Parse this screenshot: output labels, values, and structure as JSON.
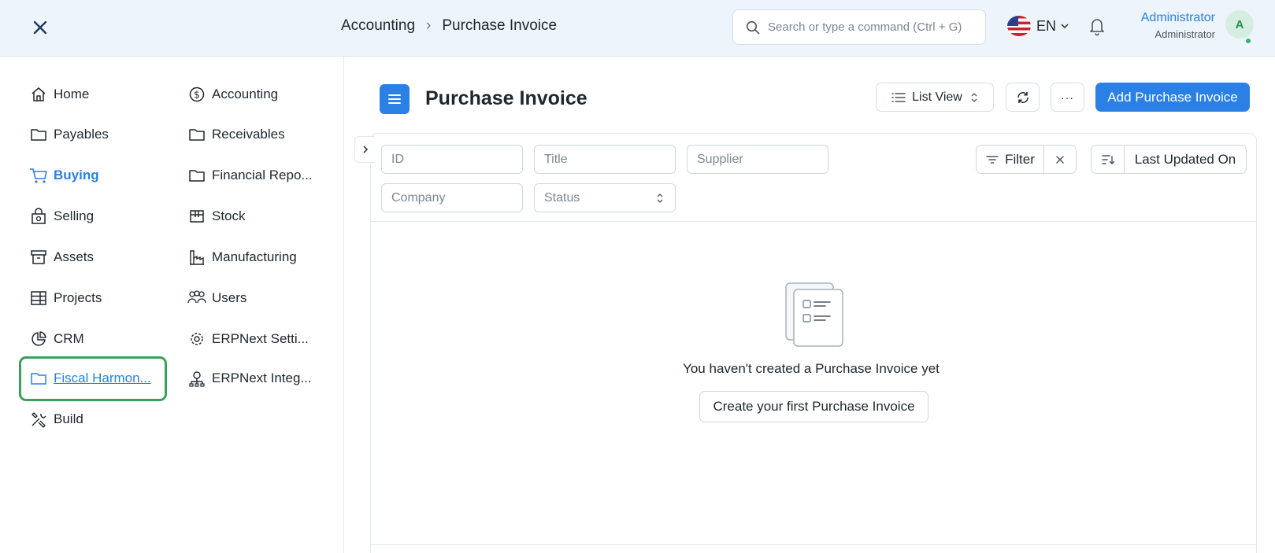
{
  "navbar": {
    "breadcrumb": [
      "Accounting",
      "Purchase Invoice"
    ],
    "search_placeholder": "Search or type a command (Ctrl + G)",
    "language": "EN",
    "user_name": "Administrator",
    "user_role": "Administrator",
    "avatar_initial": "A"
  },
  "sidebar": {
    "items": [
      {
        "label": "Home",
        "icon": "home-icon"
      },
      {
        "label": "Accounting",
        "icon": "dollar-circle-icon"
      },
      {
        "label": "Payables",
        "icon": "folder-icon"
      },
      {
        "label": "Receivables",
        "icon": "folder-icon"
      },
      {
        "label": "Buying",
        "icon": "cart-icon",
        "active": true
      },
      {
        "label": "Financial Repo...",
        "icon": "folder-icon"
      },
      {
        "label": "Selling",
        "icon": "shopping-bag-icon"
      },
      {
        "label": "Stock",
        "icon": "box-icon"
      },
      {
        "label": "Assets",
        "icon": "archive-icon"
      },
      {
        "label": "Manufacturing",
        "icon": "factory-icon"
      },
      {
        "label": "Projects",
        "icon": "server-stack-icon"
      },
      {
        "label": "Users",
        "icon": "users-icon"
      },
      {
        "label": "CRM",
        "icon": "pie-chart-icon"
      },
      {
        "label": "ERPNext Setti...",
        "icon": "gear-icon"
      },
      {
        "label": "Fiscal Harmon...",
        "icon": "folder-icon",
        "focused": true
      },
      {
        "label": "ERPNext Integ...",
        "icon": "integration-icon"
      },
      {
        "label": "Build",
        "icon": "tools-icon"
      }
    ]
  },
  "page": {
    "title": "Purchase Invoice",
    "view_label": "List View",
    "more_label": "···",
    "primary_action": "Add Purchase Invoice"
  },
  "filters": {
    "id_placeholder": "ID",
    "title_placeholder": "Title",
    "supplier_placeholder": "Supplier",
    "company_placeholder": "Company",
    "status_placeholder": "Status",
    "filter_label": "Filter",
    "sort_label": "Last Updated On"
  },
  "empty_state": {
    "message": "You haven't created a Purchase Invoice yet",
    "button": "Create your first Purchase Invoice"
  },
  "colors": {
    "primary": "#2a80e4",
    "navbar_bg": "#eef4fb",
    "focus_ring": "#3aa15a",
    "online": "#36b566"
  }
}
